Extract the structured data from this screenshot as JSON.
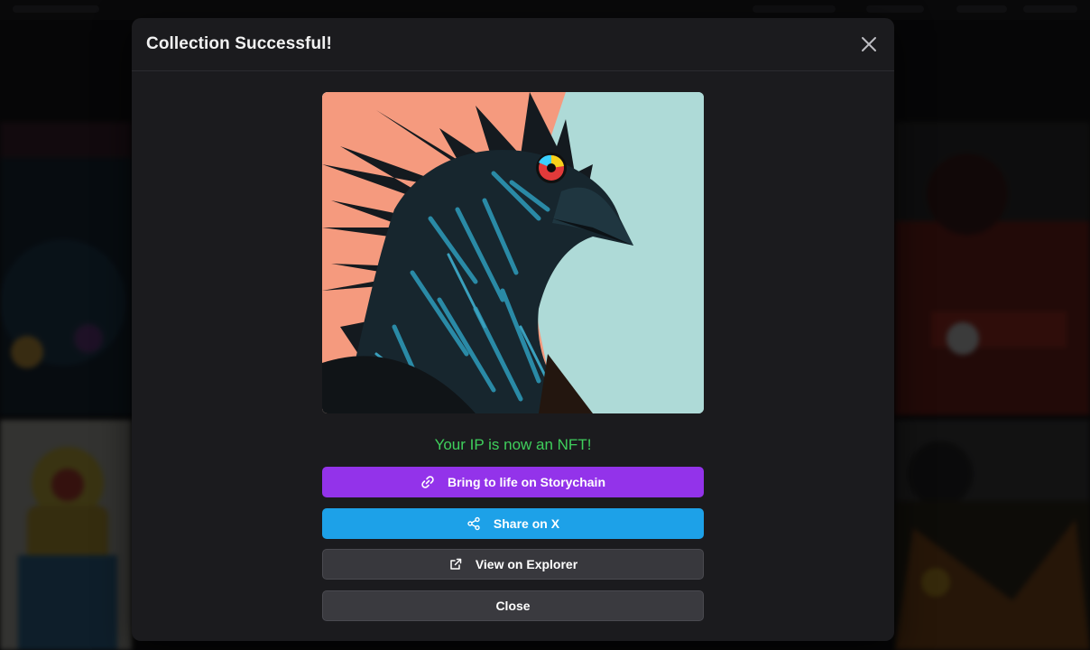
{
  "modal": {
    "title": "Collection Successful!",
    "success_message": "Your IP is now an NFT!",
    "buttons": {
      "storychain": "Bring to life on Storychain",
      "share": "Share on X",
      "explorer": "View on Explorer",
      "close": "Close"
    }
  },
  "icons": {
    "close": "close-icon",
    "storychain": "link-icon",
    "share": "share-icon",
    "explorer": "external-link-icon"
  },
  "colors": {
    "modal_bg": "#1b1b1e",
    "success_text": "#3fcf5c",
    "storychain_button": "#9333ea",
    "share_button": "#1da1e8",
    "explorer_button": "#38383d",
    "close_button": "#3a3a3f"
  }
}
